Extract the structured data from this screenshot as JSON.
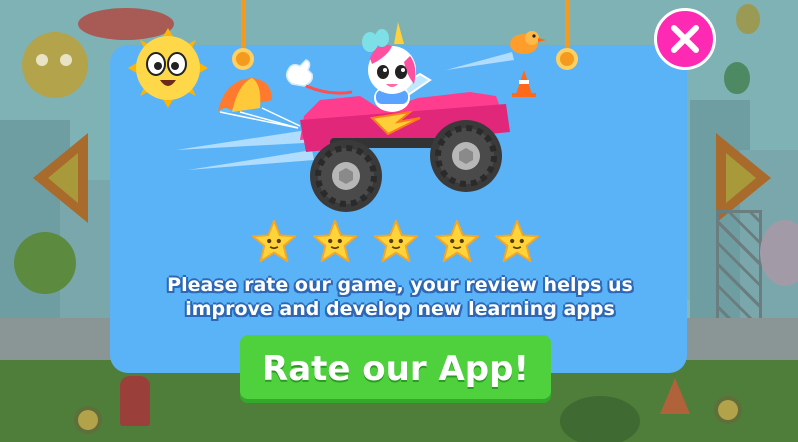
{
  "dialog": {
    "message_line1": "Please rate our game, your review helps us",
    "message_line2": "improve and develop new learning apps",
    "rate_button_label": "Rate our App!",
    "rating_stars": 5,
    "close_icon": "close-icon"
  },
  "colors": {
    "dialog_bg": "#5ab3f7",
    "rate_button": "#4ed13d",
    "close_button": "#ff2ab3",
    "star": "#ffd43b",
    "text_outline": "#2c68b6"
  },
  "icons": [
    "close-icon",
    "star-icon",
    "sun-character",
    "unicorn-character",
    "monster-truck",
    "parachute",
    "bird",
    "traffic-cone"
  ]
}
